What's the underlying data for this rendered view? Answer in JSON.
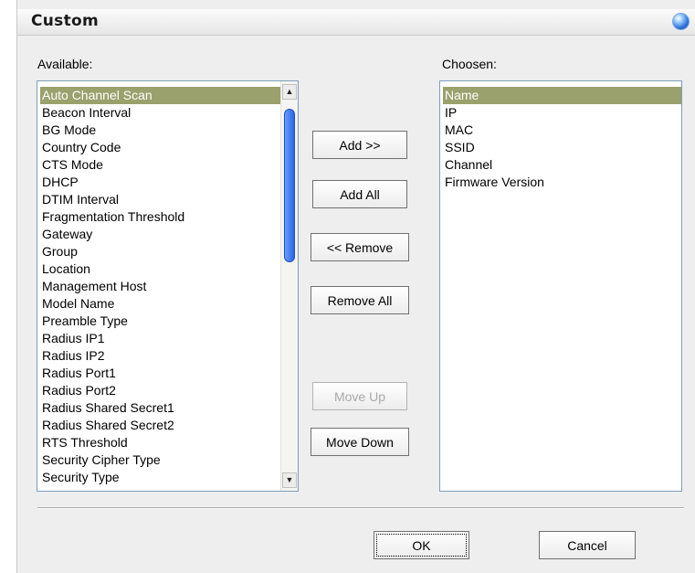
{
  "dialog": {
    "title": "Custom",
    "title_icon": "globe-icon"
  },
  "available": {
    "label": "Available:",
    "items": [
      "Auto Channel Scan",
      "Beacon Interval",
      "BG Mode",
      "Country Code",
      "CTS Mode",
      "DHCP",
      "DTIM Interval",
      "Fragmentation Threshold",
      "Gateway",
      "Group",
      "Location",
      "Management Host",
      "Model Name",
      "Preamble Type",
      "Radius IP1",
      "Radius IP2",
      "Radius Port1",
      "Radius Port2",
      "Radius Shared Secret1",
      "Radius Shared Secret2",
      "RTS Threshold",
      "Security Cipher Type",
      "Security Type"
    ],
    "selected_index": 0,
    "scroll_up_icon": "arrow-up-icon",
    "scroll_down_icon": "arrow-down-icon"
  },
  "chosen": {
    "label": "Choosen:",
    "items": [
      "Name",
      "IP",
      "MAC",
      "SSID",
      "Channel",
      "Firmware Version"
    ],
    "selected_index": 0
  },
  "buttons": {
    "add": "Add >>",
    "add_all": "Add All",
    "remove": "<< Remove",
    "remove_all": "Remove All",
    "move_up": "Move Up",
    "move_down": "Move Down",
    "ok": "OK",
    "cancel": "Cancel"
  },
  "colors": {
    "selection": "#9aa16c",
    "scroll_thumb": "#2c63e8"
  }
}
